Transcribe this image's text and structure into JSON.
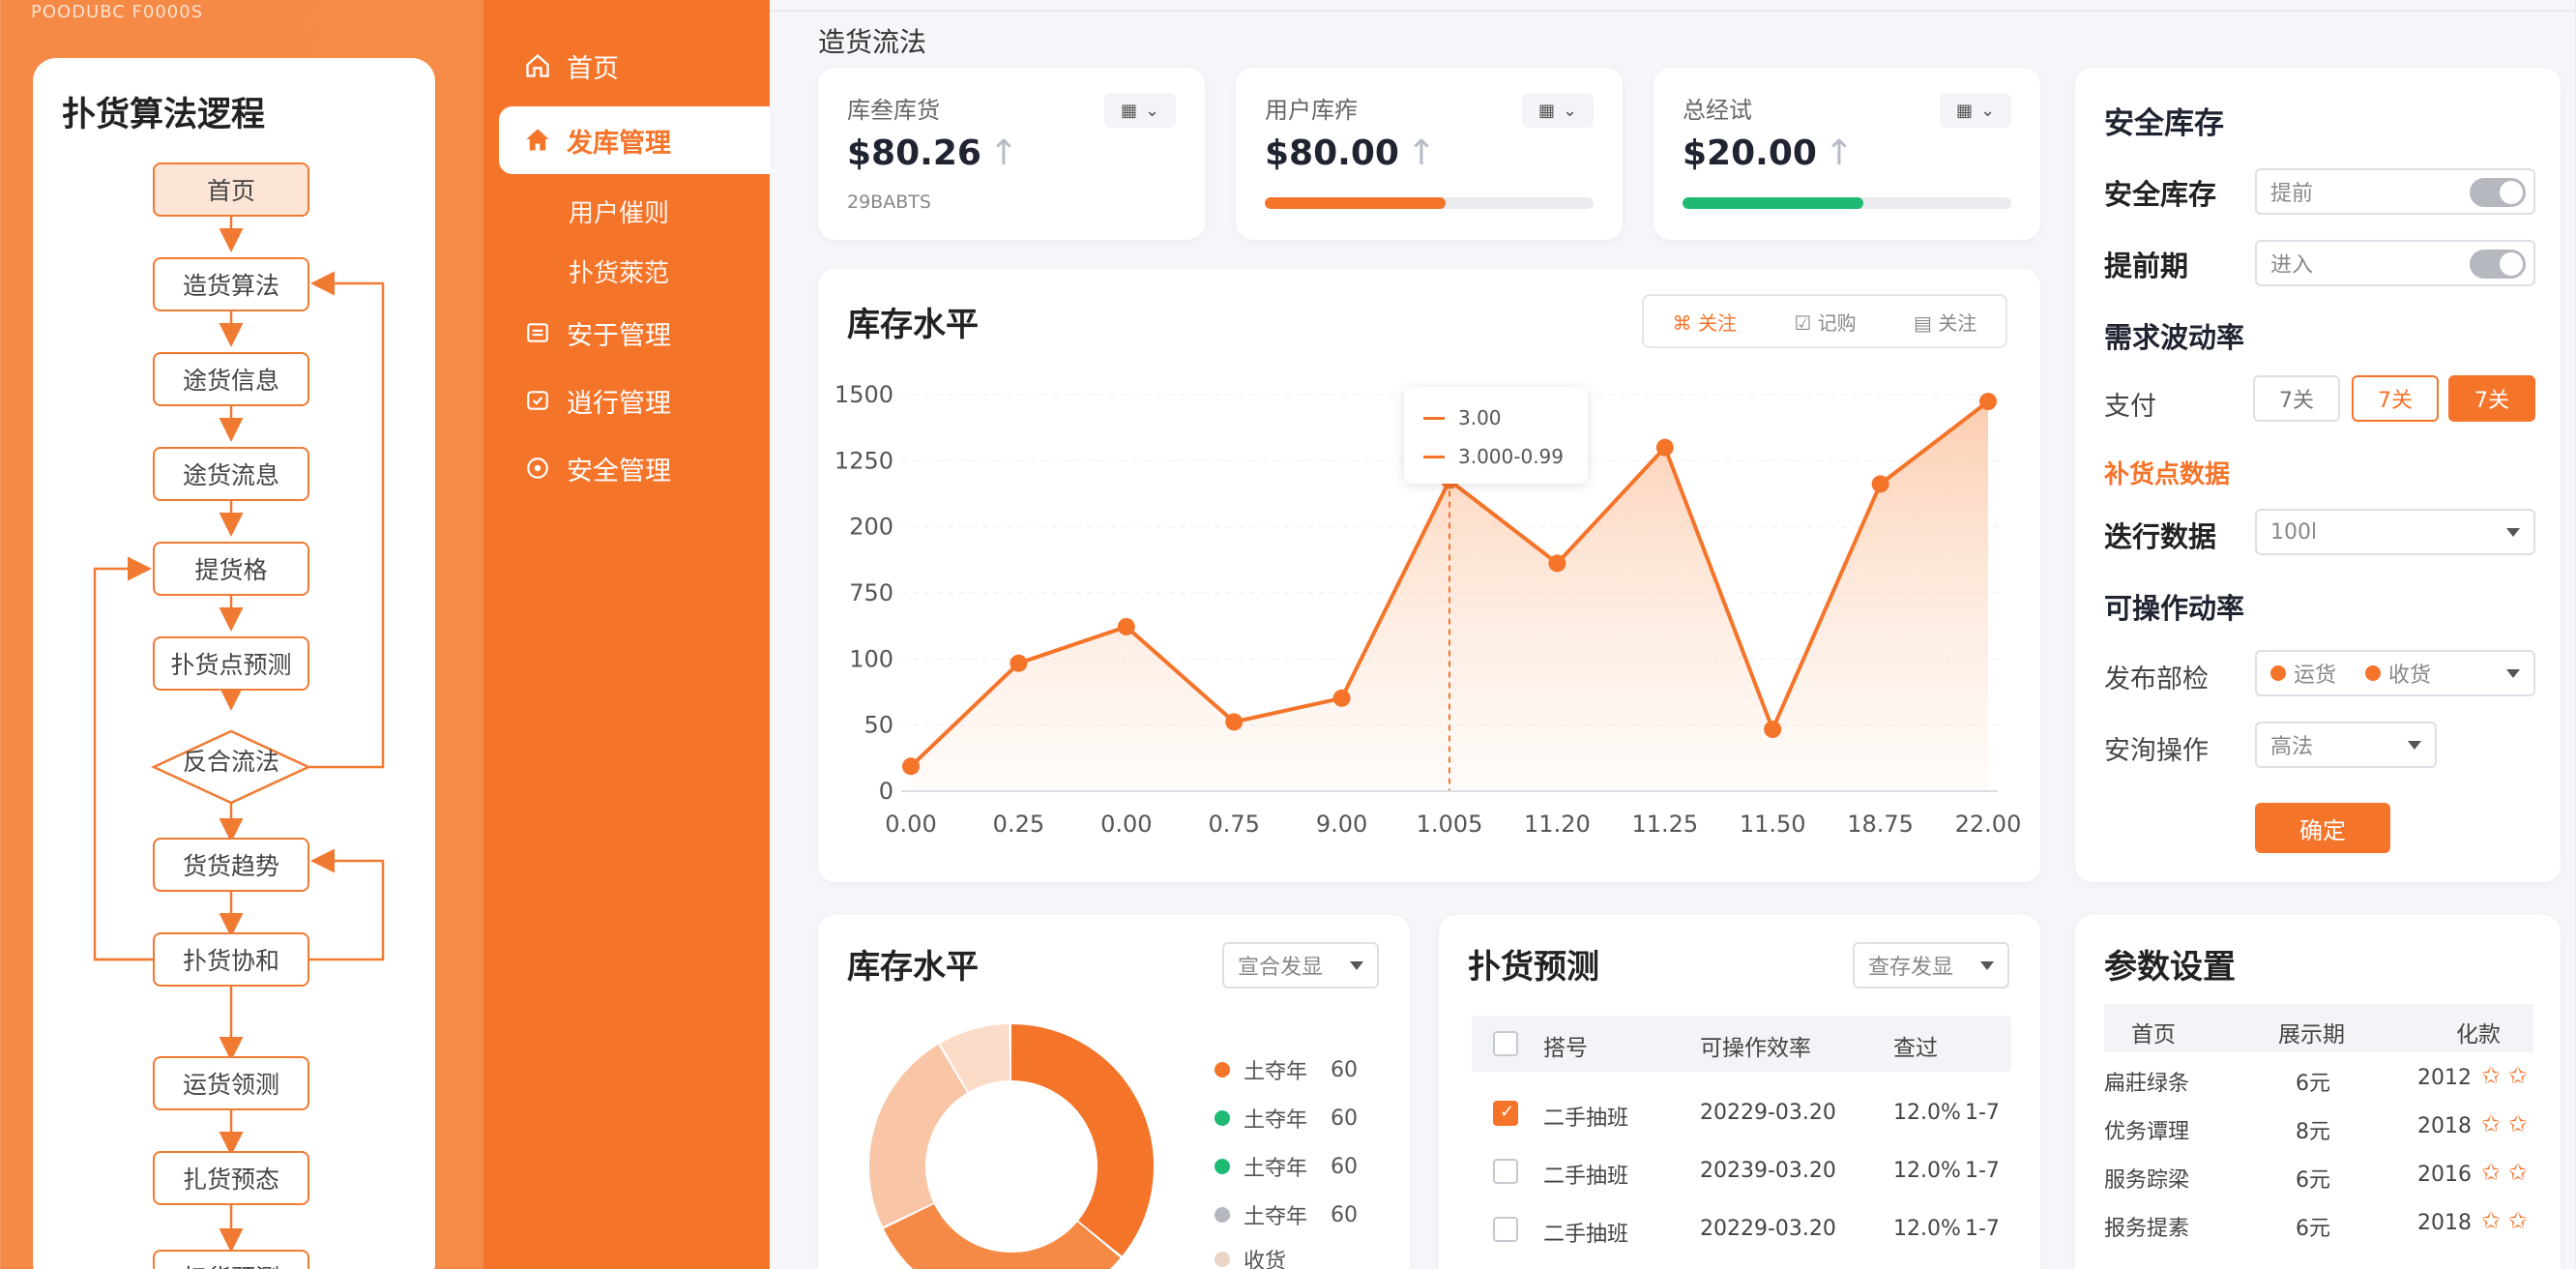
{
  "top_code": "POODUBC F0000S",
  "page_title": "造货流法",
  "flow": {
    "title": "扑货算法逻程",
    "nodes": [
      "首页",
      "造货算法",
      "途货信息",
      "途货流息",
      "提货格",
      "扑货点预测",
      "反合流法",
      "货货趋势",
      "扑货协和",
      "运货领测",
      "扎货预态",
      "扫货预测"
    ]
  },
  "nav": {
    "items": [
      {
        "label": "首页",
        "icon": "home-icon"
      },
      {
        "label": "发库管理",
        "icon": "home-solid-icon",
        "active": true
      },
      {
        "label": "安于管理",
        "icon": "doc-icon"
      },
      {
        "label": "逍行管理",
        "icon": "check-box-icon"
      },
      {
        "label": "安全管理",
        "icon": "shield-icon"
      }
    ],
    "sub": [
      "用户催则",
      "扑货萊范"
    ]
  },
  "stats": [
    {
      "label": "库叁库货",
      "value": "$80.26",
      "arrow": "↑",
      "sub": "29BABTS"
    },
    {
      "label": "用户库痄",
      "value": "$80.00",
      "arrow": "↑",
      "progress": 0.55,
      "color": "#f4742a"
    },
    {
      "label": "总经试",
      "value": "$20.00",
      "arrow": "↑",
      "progress": 0.55,
      "color": "#1fba72"
    }
  ],
  "main_chart": {
    "title": "库存水平",
    "segments": [
      "关注",
      "记购",
      "关注"
    ],
    "tooltip": {
      "line1": "3.00",
      "line2": "3.000-0.99"
    }
  },
  "chart_data": {
    "type": "area",
    "categories": [
      "0.00",
      "0.25",
      "0.00",
      "0.75",
      "9.00",
      "1.005",
      "11.20",
      "11.25",
      "11.50",
      "18.75",
      "22.00"
    ],
    "y_tick_labels": [
      "1500",
      "1250",
      "200",
      "750",
      "100",
      "50",
      "0"
    ],
    "values": [
      94,
      484,
      622,
      262,
      352,
      1176,
      862,
      1300,
      234,
      1162,
      1474
    ],
    "ylim": [
      0,
      1500
    ],
    "grid": true,
    "highlight_index": 5
  },
  "settings": {
    "title": "安全库存",
    "row1": {
      "label": "安全库存",
      "placeholder": "提前"
    },
    "row2": {
      "label": "提前期",
      "placeholder": "进入"
    },
    "section2": "需求波动率",
    "row3": {
      "label": "支付",
      "pills": [
        "7关",
        "7关",
        "7关"
      ]
    },
    "link": "补货点数据",
    "row4": {
      "label": "迭行数据",
      "value": "100l"
    },
    "section3": "可操作动率",
    "row5": {
      "label": "发布部检",
      "opt1": "运货",
      "opt2": "收货"
    },
    "row6": {
      "label": "安洵操作",
      "value": "高法"
    },
    "confirm": "确定"
  },
  "donut_card": {
    "title": "库存水平",
    "select": "宣合发显",
    "legend": [
      {
        "label": "土夺年",
        "value": "60",
        "color": "#f4742a"
      },
      {
        "label": "土夺年",
        "value": "60",
        "color": "#1fba72"
      },
      {
        "label": "土夺年",
        "value": "60",
        "color": "#1fba72"
      },
      {
        "label": "土夺年",
        "value": "60",
        "color": "#b5b8be"
      },
      {
        "label": "收货",
        "value": "",
        "color": "#e8d5c6"
      }
    ]
  },
  "forecast": {
    "title": "扑货预测",
    "select": "查存发显",
    "headers": [
      "搭号",
      "可操作效率",
      "查过"
    ],
    "rows": [
      {
        "checked": true,
        "name": "二手抽班",
        "date": "20229-03.20",
        "pct": "12.0%",
        "range": "1-7"
      },
      {
        "checked": false,
        "name": "二手抽班",
        "date": "20239-03.20",
        "pct": "12.0%",
        "range": "1-7"
      },
      {
        "checked": false,
        "name": "二手抽班",
        "date": "20229-03.20",
        "pct": "12.0%",
        "range": "1-7"
      }
    ]
  },
  "params": {
    "title": "参数设置",
    "headers": [
      "首页",
      "展示期",
      "化款"
    ],
    "rows": [
      {
        "name": "扁莊绿条",
        "val": "6元",
        "year": "2012"
      },
      {
        "name": "优务谭理",
        "val": "8元",
        "year": "2018"
      },
      {
        "name": "服务踪梁",
        "val": "6元",
        "year": "2016"
      },
      {
        "name": "报务提素",
        "val": "6元",
        "year": "2018"
      }
    ]
  },
  "colors": {
    "accent": "#f4742a",
    "green": "#1fba72"
  }
}
